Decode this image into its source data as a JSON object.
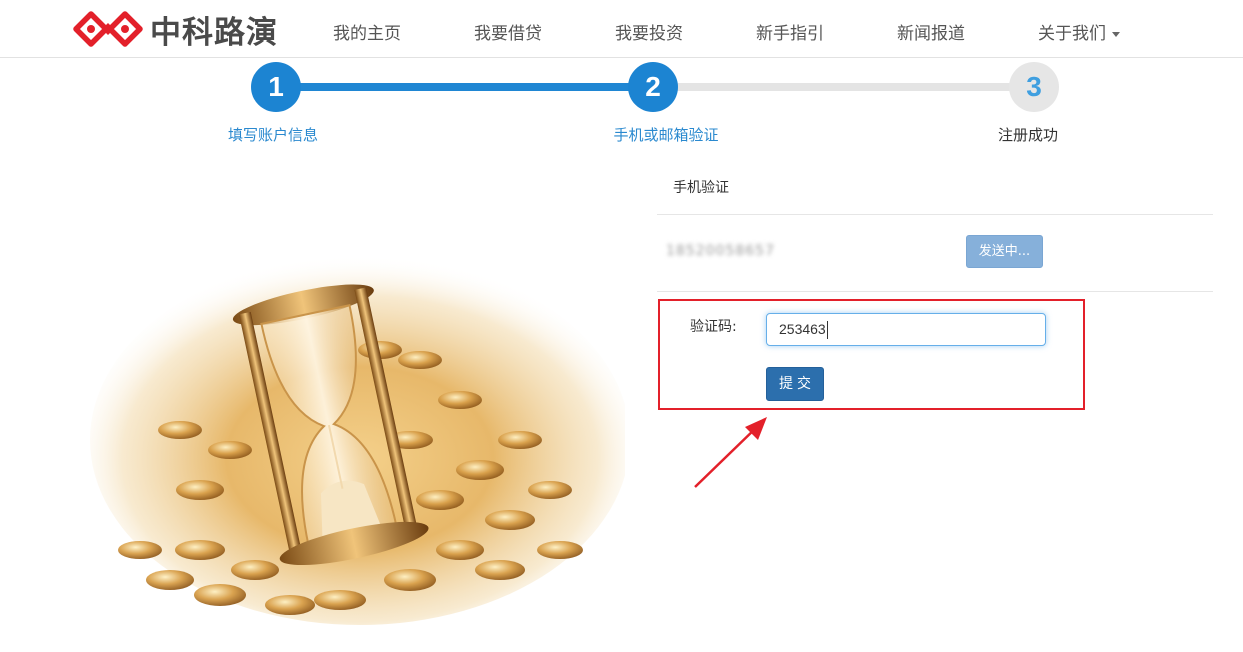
{
  "brand": {
    "name": "中科路演",
    "logo_color": "#e3202a"
  },
  "nav": {
    "items": [
      "我的主页",
      "我要借贷",
      "我要投资",
      "新手指引",
      "新闻报道"
    ],
    "dropdown_label": "关于我们"
  },
  "steps": [
    {
      "number": "1",
      "label": "填写账户信息",
      "state": "done"
    },
    {
      "number": "2",
      "label": "手机或邮箱验证",
      "state": "active"
    },
    {
      "number": "3",
      "label": "注册成功",
      "state": "pending"
    }
  ],
  "verification": {
    "section_title": "手机验证",
    "phone_masked": "18520058657",
    "send_button_label": "发送中...",
    "code_label": "验证码:",
    "code_value": "253463",
    "submit_label": "提交"
  },
  "colors": {
    "accent": "#1c84d2",
    "highlight_box": "#e3202a",
    "submit_button": "#2c6fad",
    "send_button": "#86b0da"
  },
  "illustration": {
    "icon": "hourglass-on-coins-image"
  },
  "annotation": {
    "icon": "red-arrow-icon"
  }
}
